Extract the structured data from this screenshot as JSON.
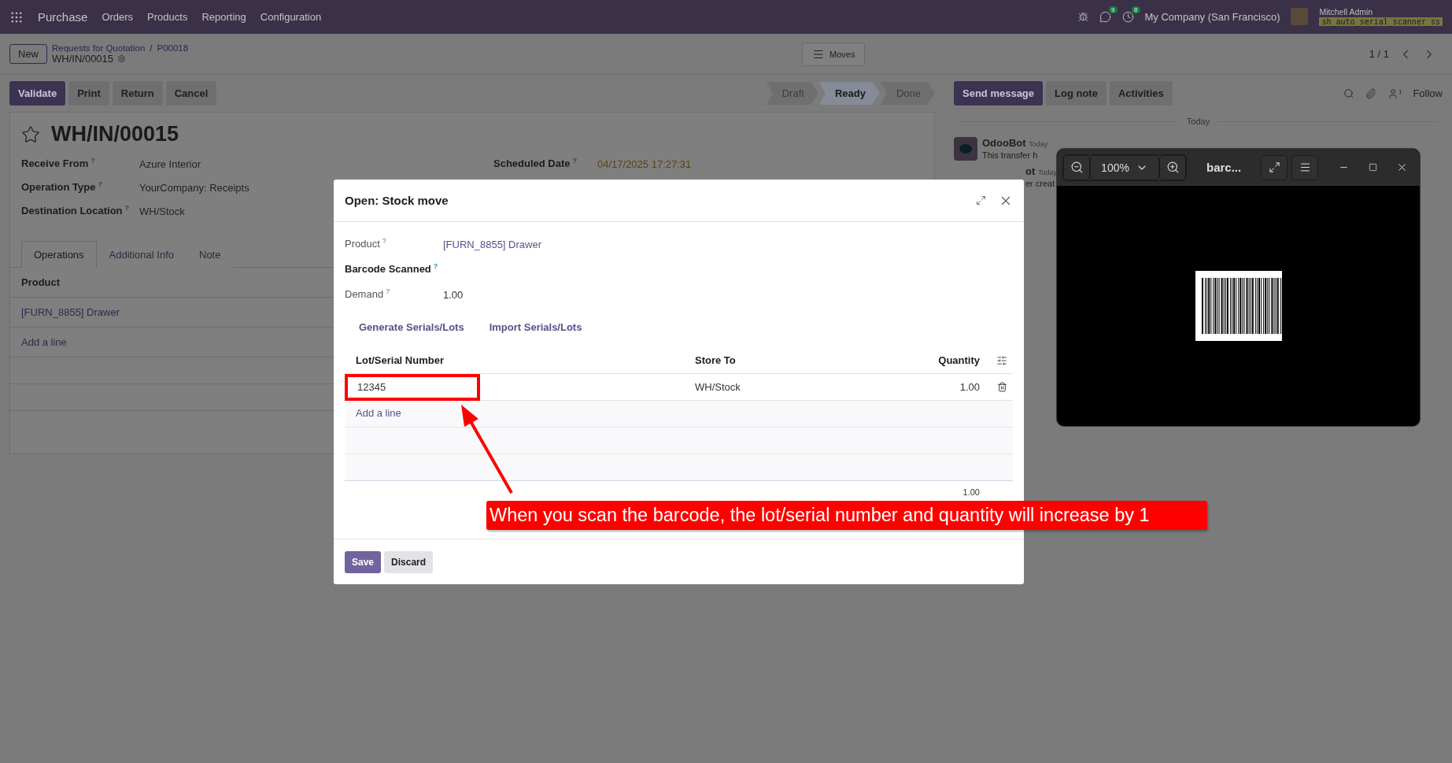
{
  "navbar": {
    "app_name": "Purchase",
    "menu": [
      "Orders",
      "Products",
      "Reporting",
      "Configuration"
    ],
    "messages_count": "9",
    "activities_count": "8",
    "company": "My Company (San Francisco)",
    "user": "Mitchell Admin",
    "database": "sh_auto_serial_scanner_ss"
  },
  "control_panel": {
    "new_button": "New",
    "breadcrumb": [
      "Requests for Quotation",
      "P00018"
    ],
    "breadcrumb_separator": "/",
    "record": "WH/IN/00015",
    "moves_button": "Moves",
    "pager": "1 / 1"
  },
  "actions": [
    {
      "label": "Validate",
      "kind": "primary"
    },
    {
      "label": "Print",
      "kind": "secondary"
    },
    {
      "label": "Return",
      "kind": "secondary"
    },
    {
      "label": "Cancel",
      "kind": "secondary"
    }
  ],
  "status_bar": [
    {
      "label": "Draft",
      "selected": false
    },
    {
      "label": "Ready",
      "selected": true
    },
    {
      "label": "Done",
      "selected": false
    }
  ],
  "form": {
    "title": "WH/IN/00015",
    "starred": false,
    "fields": [
      {
        "label": "Receive From",
        "help": "?",
        "value": "Azure Interior"
      },
      {
        "label": "Operation Type",
        "help": "?",
        "value": "YourCompany: Receipts"
      },
      {
        "label": "Destination Location",
        "help": "?",
        "value": "WH/Stock"
      }
    ],
    "scheduled_date": {
      "label": "Scheduled Date",
      "help": "?",
      "value": "04/17/2025 17:27:31"
    },
    "tabs": [
      {
        "label": "Operations",
        "selected": true
      },
      {
        "label": "Additional Info",
        "selected": false
      },
      {
        "label": "Note",
        "selected": false
      }
    ],
    "table": {
      "column": "Product",
      "rows": [
        "[FURN_8855] Drawer"
      ],
      "add_line": "Add a line"
    }
  },
  "chatter": {
    "buttons": [
      {
        "label": "Send message",
        "selected": true
      },
      {
        "label": "Log note",
        "selected": false
      },
      {
        "label": "Activities",
        "selected": false
      }
    ],
    "followers": "1",
    "follow": "Follow",
    "date": "Today",
    "messages": [
      {
        "kind": "full",
        "author": "OdooBot",
        "time": "Today",
        "text": "This transfer h"
      },
      {
        "kind": "cut",
        "author": "ot",
        "time": "Today",
        "text": "er creat"
      }
    ]
  },
  "dialog": {
    "title": "Open: Stock move",
    "fields": [
      {
        "label": "Product",
        "help": "?",
        "value": "[FURN_8855] Drawer",
        "kind": "link"
      },
      {
        "label": "Barcode Scanned",
        "help": "?",
        "kind": "empty"
      },
      {
        "label": "Demand",
        "help": "?",
        "value": "1.00",
        "kind": "text"
      }
    ],
    "links": [
      "Generate Serials/Lots",
      "Import Serials/Lots"
    ],
    "columns": [
      "Lot/Serial Number",
      "Store To",
      "Quantity"
    ],
    "rows": [
      {
        "lot": "12345",
        "location": "WH/Stock",
        "quantity": "1.00",
        "highlighted": true
      }
    ],
    "add_line": "Add a line",
    "total": "1.00",
    "save": "Save",
    "discard": "Discard"
  },
  "viewer": {
    "zoom": "100%",
    "title": "barc..."
  },
  "callout": {
    "text": "When you scan the barcode, the lot/serial number and quantity will increase by 1"
  }
}
